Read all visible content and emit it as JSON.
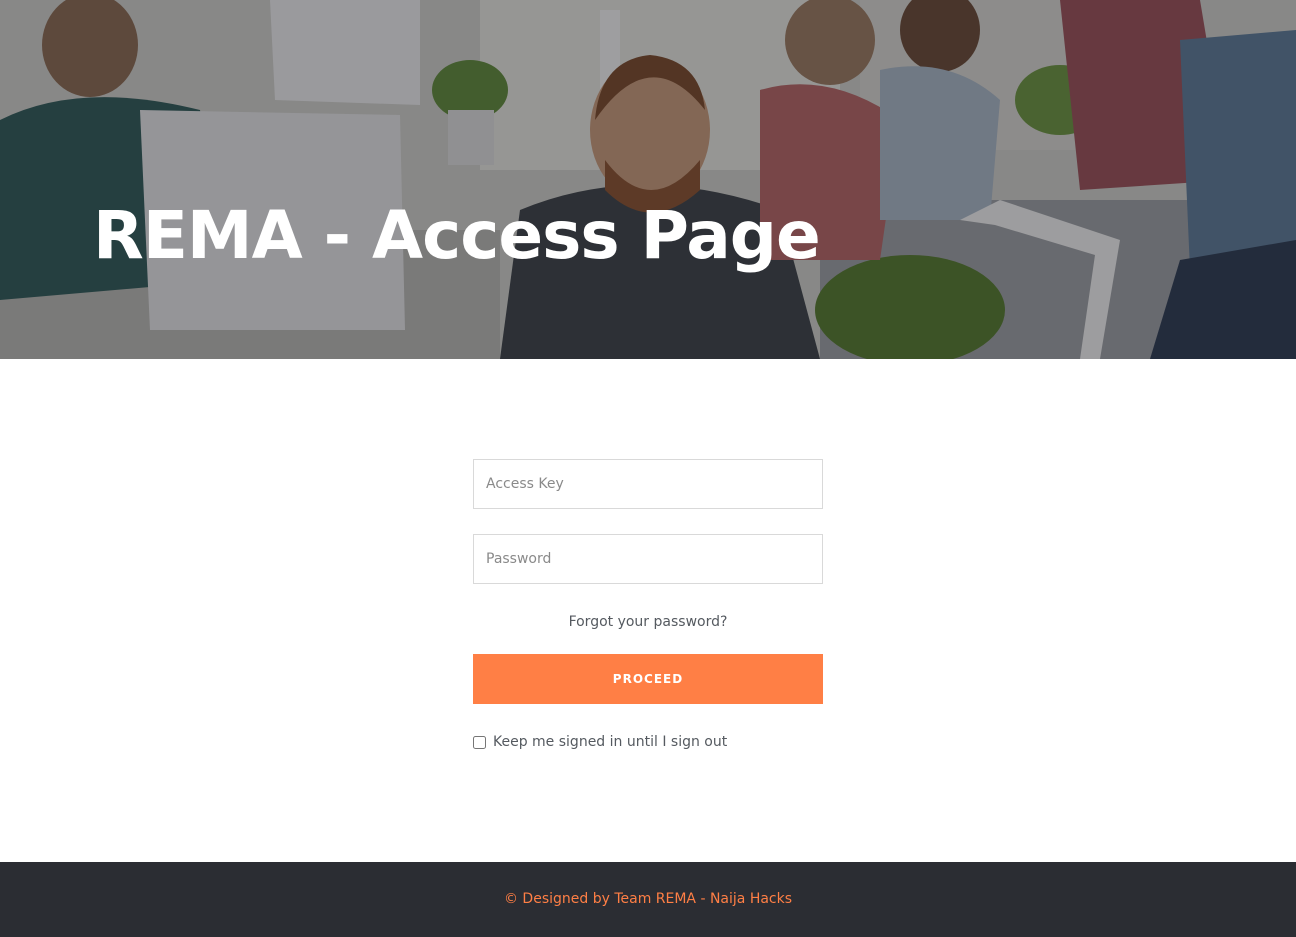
{
  "hero": {
    "title": "REMA - Access Page"
  },
  "form": {
    "access_key_placeholder": "Access Key",
    "access_key_value": "",
    "password_placeholder": "Password",
    "password_value": "",
    "forgot_label": "Forgot your password?",
    "proceed_label": "PROCEED",
    "keep_signed_label": "Keep me signed in until I sign out",
    "keep_signed_checked": false
  },
  "footer": {
    "text": "© Designed by Team REMA - Naija Hacks"
  },
  "colors": {
    "accent": "#ff7f45",
    "footer_bg": "#2b2d33"
  }
}
